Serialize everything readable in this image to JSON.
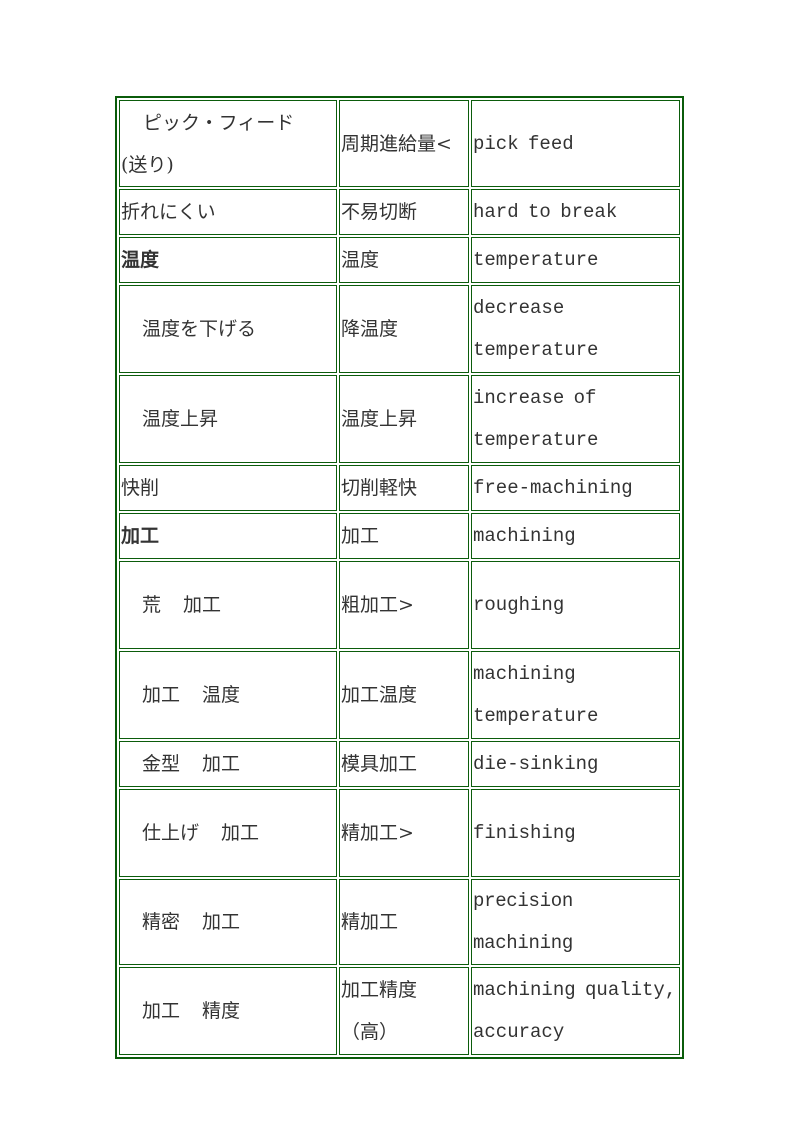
{
  "document": {
    "type": "glossary-table",
    "columns": [
      "japanese",
      "chinese",
      "english"
    ],
    "rows": [
      {
        "ja": "ピック・フィード",
        "ja_line2": "(送り)",
        "zh": "周期進給量<",
        "en": "pick feed",
        "ja_indent": true,
        "ja_bold": false
      },
      {
        "ja": "折れにくい",
        "zh": "不易切断",
        "en": "hard to break",
        "ja_indent": false,
        "ja_bold": false
      },
      {
        "ja": "温度",
        "zh": "温度",
        "en": "temperature",
        "ja_indent": false,
        "ja_bold": true
      },
      {
        "ja": "温度を下げる",
        "zh": "降温度",
        "en": "decrease temperature",
        "ja_indent": true,
        "ja_bold": false
      },
      {
        "ja": "温度上昇",
        "zh": "温度上昇",
        "en": "increase of temperature",
        "ja_indent": true,
        "ja_bold": false
      },
      {
        "ja": "快削",
        "zh": "切削軽快",
        "en": "free-machining",
        "ja_indent": false,
        "ja_bold": false
      },
      {
        "ja": "加工",
        "zh": "加工",
        "en": "machining",
        "ja_indent": false,
        "ja_bold": true
      },
      {
        "ja_a": "荒",
        "ja_b": "加工",
        "zh": "粗加工>",
        "en": "roughing",
        "ja_indent": true,
        "ja_bold": false
      },
      {
        "ja_a": "加工",
        "ja_b": "温度",
        "zh": "加工温度",
        "en": "machining temperature",
        "ja_indent": true,
        "ja_bold": false
      },
      {
        "ja_a": "金型",
        "ja_b": "加工",
        "zh": "模具加工",
        "en": "die-sinking",
        "ja_indent": true,
        "ja_bold": false
      },
      {
        "ja_a": "仕上げ",
        "ja_b": "加工",
        "zh": "精加工>",
        "en": "finishing",
        "ja_indent": true,
        "ja_bold": false
      },
      {
        "ja_a": "精密",
        "ja_b": "加工",
        "zh": "精加工",
        "en": "precision machining",
        "ja_indent": true,
        "ja_bold": false
      },
      {
        "ja_a": "加工",
        "ja_b": "精度",
        "zh": "加工精度",
        "zh_line2": "（高）",
        "en": "machining quality, accuracy",
        "ja_indent": true,
        "ja_bold": false
      }
    ]
  },
  "colors": {
    "border": "#0b5c0b",
    "text": "#333333",
    "background": "#ffffff"
  }
}
